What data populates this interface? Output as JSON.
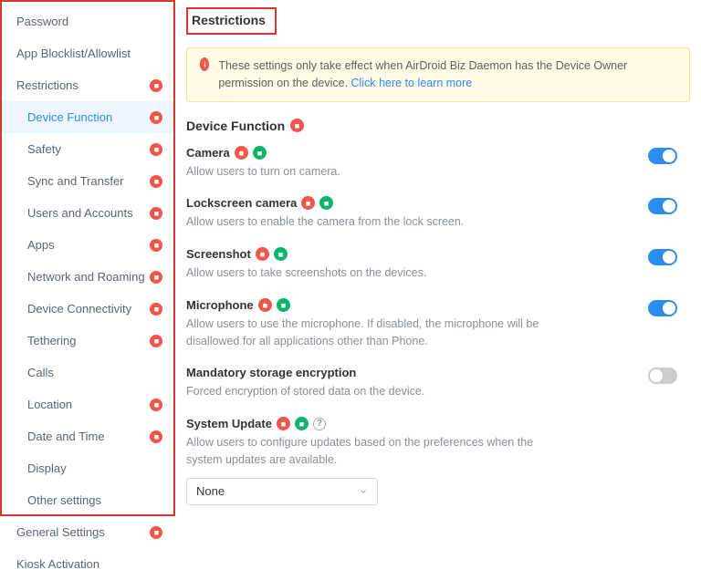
{
  "sidebar": {
    "items": [
      {
        "label": "Password",
        "badge": false,
        "sub": false,
        "selected": false
      },
      {
        "label": "App Blocklist/Allowlist",
        "badge": false,
        "sub": false,
        "selected": false
      },
      {
        "label": "Restrictions",
        "badge": true,
        "sub": false,
        "selected": false
      },
      {
        "label": "Device Function",
        "badge": true,
        "sub": true,
        "selected": true
      },
      {
        "label": "Safety",
        "badge": true,
        "sub": true,
        "selected": false
      },
      {
        "label": "Sync and Transfer",
        "badge": true,
        "sub": true,
        "selected": false
      },
      {
        "label": "Users and Accounts",
        "badge": true,
        "sub": true,
        "selected": false
      },
      {
        "label": "Apps",
        "badge": true,
        "sub": true,
        "selected": false
      },
      {
        "label": "Network and Roaming",
        "badge": true,
        "sub": true,
        "selected": false
      },
      {
        "label": "Device Connectivity",
        "badge": true,
        "sub": true,
        "selected": false
      },
      {
        "label": "Tethering",
        "badge": true,
        "sub": true,
        "selected": false
      },
      {
        "label": "Calls",
        "badge": false,
        "sub": true,
        "selected": false
      },
      {
        "label": "Location",
        "badge": true,
        "sub": true,
        "selected": false
      },
      {
        "label": "Date and Time",
        "badge": true,
        "sub": true,
        "selected": false
      },
      {
        "label": "Display",
        "badge": false,
        "sub": true,
        "selected": false
      },
      {
        "label": "Other settings",
        "badge": false,
        "sub": true,
        "selected": false
      },
      {
        "label": "General Settings",
        "badge": true,
        "sub": false,
        "selected": false
      },
      {
        "label": "Kiosk Activation",
        "badge": false,
        "sub": false,
        "selected": false
      }
    ]
  },
  "page": {
    "title": "Restrictions",
    "notice": "These settings only take effect when AirDroid Biz Daemon has the Device Owner permission on the device.  ",
    "notice_link": "Click here to learn more",
    "section": "Device Function"
  },
  "settings": [
    {
      "label": "Camera",
      "desc": "Allow users to turn on camera.",
      "badges": [
        "red",
        "green"
      ],
      "toggle": true
    },
    {
      "label": "Lockscreen camera",
      "desc": "Allow users to enable the camera from the lock screen.",
      "badges": [
        "red",
        "green"
      ],
      "toggle": true
    },
    {
      "label": "Screenshot",
      "desc": "Allow users to take screenshots on the devices.",
      "badges": [
        "red",
        "green"
      ],
      "toggle": true
    },
    {
      "label": "Microphone",
      "desc": "Allow users to use the microphone. If disabled, the microphone will be disallowed for all applications other than Phone.",
      "badges": [
        "red",
        "green"
      ],
      "toggle": true
    },
    {
      "label": "Mandatory storage encryption",
      "desc": "Forced encryption of stored data on the device.",
      "badges": [],
      "toggle": false
    },
    {
      "label": "System Update",
      "desc": "Allow users to configure updates based on the preferences when the system updates are available.",
      "badges": [
        "red",
        "green",
        "q"
      ],
      "select": "None"
    }
  ]
}
